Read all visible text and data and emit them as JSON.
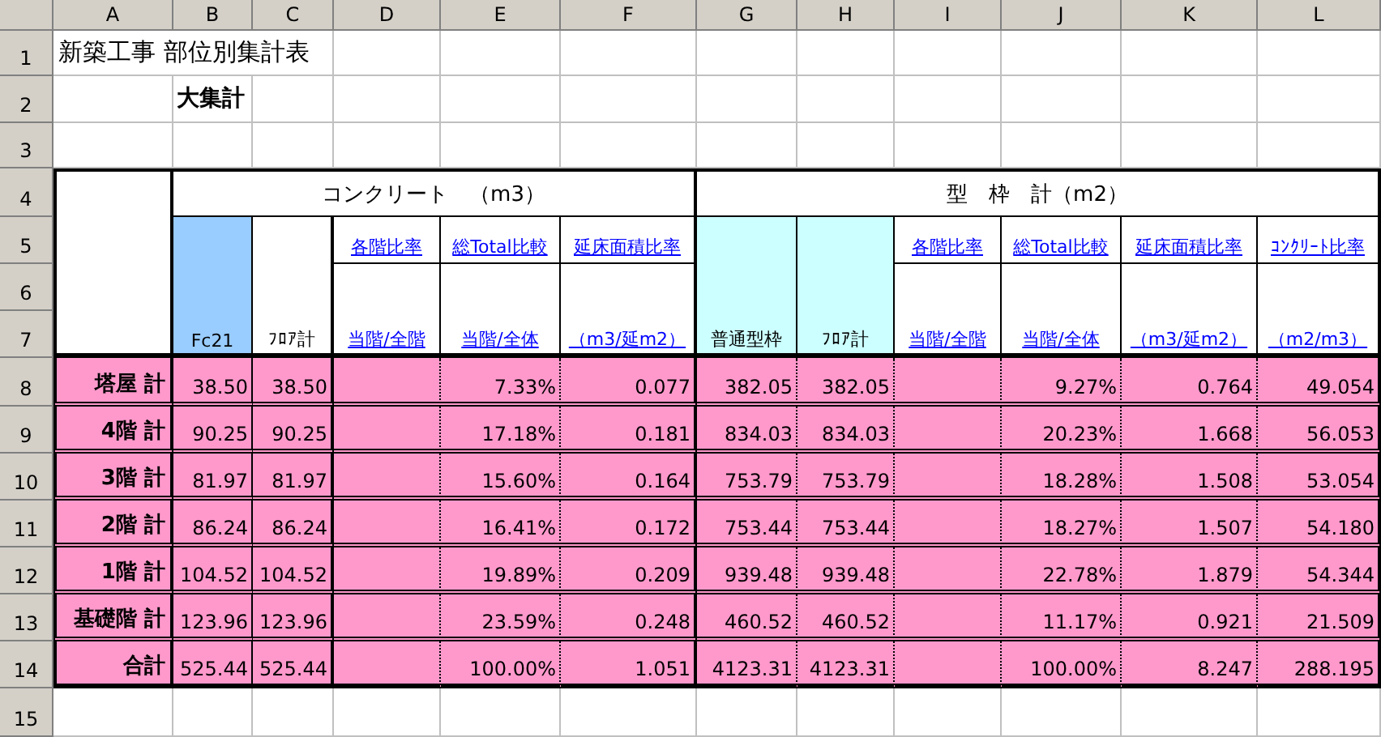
{
  "sheet": {
    "column_headers": [
      "A",
      "B",
      "C",
      "D",
      "E",
      "F",
      "G",
      "H",
      "I",
      "J",
      "K",
      "L"
    ],
    "row_headers": [
      "1",
      "2",
      "3",
      "4",
      "5",
      "6",
      "7",
      "8",
      "9",
      "10",
      "11",
      "12",
      "13",
      "14",
      "15"
    ]
  },
  "title": "新築工事 部位別集計表",
  "subtitle": "大集計",
  "groups": [
    {
      "title": "コンクリート　（m3）",
      "columns": [
        {
          "kind": "quantity",
          "label": "Fc21",
          "color": "#99ccff"
        },
        {
          "kind": "quantity",
          "label": "ﾌﾛｱ計",
          "color": "#ffffff"
        },
        {
          "kind": "ratio",
          "label": "各階比率",
          "unit": "当階/全階"
        },
        {
          "kind": "ratio",
          "label": "総Total比較",
          "unit": "当階/全体"
        },
        {
          "kind": "ratio",
          "label": "延床面積比率",
          "unit": "（m3/延m2）"
        }
      ]
    },
    {
      "title": "型　枠　計（m2）",
      "columns": [
        {
          "kind": "quantity",
          "label": "普通型枠",
          "color": "#ccffff"
        },
        {
          "kind": "quantity",
          "label": "ﾌﾛｱ計",
          "color": "#ccffff"
        },
        {
          "kind": "ratio",
          "label": "各階比率",
          "unit": "当階/全階"
        },
        {
          "kind": "ratio",
          "label": "総Total比較",
          "unit": "当階/全体"
        },
        {
          "kind": "ratio",
          "label": "延床面積比率",
          "unit": "（m3/延m2）"
        },
        {
          "kind": "ratio",
          "label": "ｺﾝｸﾘｰﾄ比率",
          "unit": "（m2/m3）"
        }
      ]
    }
  ],
  "rows": [
    {
      "label": "塔屋 計",
      "values": [
        "38.50",
        "38.50",
        "7.33%",
        "0.077",
        "382.05",
        "382.05",
        "9.27%",
        "0.764",
        "49.054"
      ]
    },
    {
      "label": "4階 計",
      "values": [
        "90.25",
        "90.25",
        "17.18%",
        "0.181",
        "834.03",
        "834.03",
        "20.23%",
        "1.668",
        "56.053"
      ]
    },
    {
      "label": "3階 計",
      "values": [
        "81.97",
        "81.97",
        "15.60%",
        "0.164",
        "753.79",
        "753.79",
        "18.28%",
        "1.508",
        "53.054"
      ]
    },
    {
      "label": "2階 計",
      "values": [
        "86.24",
        "86.24",
        "16.41%",
        "0.172",
        "753.44",
        "753.44",
        "18.27%",
        "1.507",
        "54.180"
      ]
    },
    {
      "label": "1階 計",
      "values": [
        "104.52",
        "104.52",
        "19.89%",
        "0.209",
        "939.48",
        "939.48",
        "22.78%",
        "1.879",
        "54.344"
      ]
    },
    {
      "label": "基礎階 計",
      "values": [
        "123.96",
        "123.96",
        "23.59%",
        "0.248",
        "460.52",
        "460.52",
        "11.17%",
        "0.921",
        "21.509"
      ]
    },
    {
      "label": "合計",
      "values": [
        "525.44",
        "525.44",
        "100.00%",
        "1.051",
        "4123.31",
        "4123.31",
        "100.00%",
        "8.247",
        "288.195"
      ]
    }
  ]
}
